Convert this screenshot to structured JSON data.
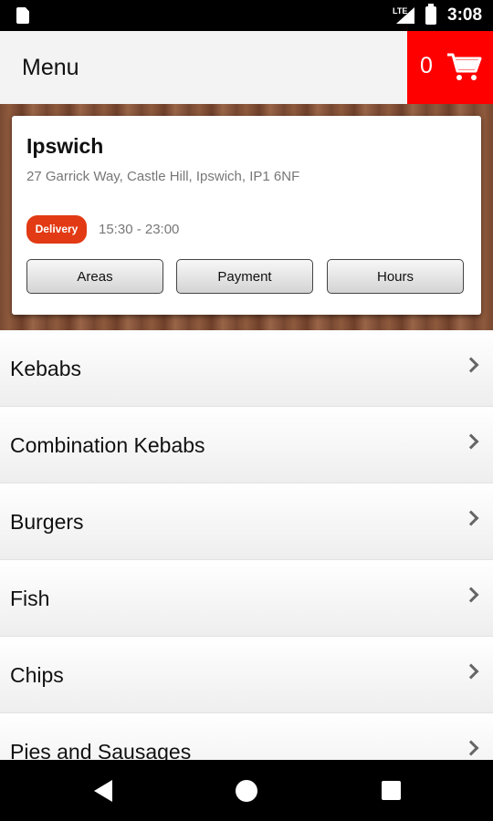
{
  "status_bar": {
    "network": "LTE",
    "time": "3:08"
  },
  "app_bar": {
    "title": "Menu",
    "cart_count": "0"
  },
  "store": {
    "name": "Ipswich",
    "address": "27 Garrick Way, Castle Hill, Ipswich, IP1 6NF",
    "delivery_label": "Delivery",
    "delivery_hours": "15:30 - 23:00",
    "buttons": {
      "areas": "Areas",
      "payment": "Payment",
      "hours": "Hours"
    }
  },
  "menu": {
    "items": [
      {
        "label": "Kebabs"
      },
      {
        "label": "Combination Kebabs"
      },
      {
        "label": "Burgers"
      },
      {
        "label": "Fish"
      },
      {
        "label": "Chips"
      },
      {
        "label": "Pies and Sausages"
      }
    ]
  },
  "colors": {
    "accent": "#ff0000",
    "delivery_badge": "#e23a14"
  }
}
